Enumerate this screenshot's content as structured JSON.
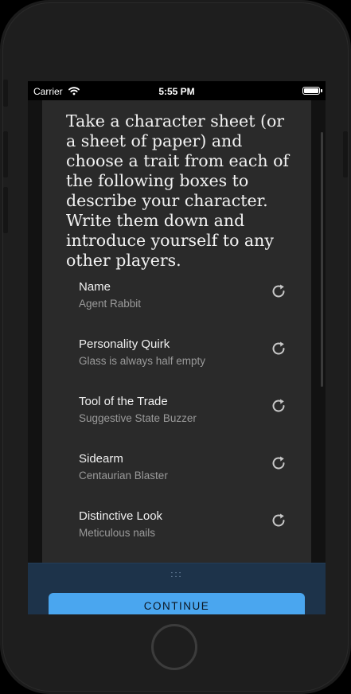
{
  "status_bar": {
    "carrier": "Carrier",
    "time": "5:55 PM",
    "wifi_icon": "wifi-icon",
    "battery_icon": "battery-icon"
  },
  "intro_text": "Take a character sheet (or a sheet of paper) and choose a trait from each of the following boxes to describe your character. Write them down and introduce yourself to any other players.",
  "traits": [
    {
      "label": "Name",
      "value": "Agent Rabbit"
    },
    {
      "label": "Personality Quirk",
      "value": "Glass is always half empty"
    },
    {
      "label": "Tool of the Trade",
      "value": "Suggestive State Buzzer"
    },
    {
      "label": "Sidearm",
      "value": "Centaurian Blaster"
    },
    {
      "label": "Distinctive Look",
      "value": "Meticulous nails"
    }
  ],
  "sheet": {
    "handle": ":::",
    "continue_label": "CONTINUE"
  },
  "colors": {
    "background": "#121212",
    "card": "#2a2a2a",
    "sheet": "#1d334a",
    "accent": "#4aa6ef"
  }
}
